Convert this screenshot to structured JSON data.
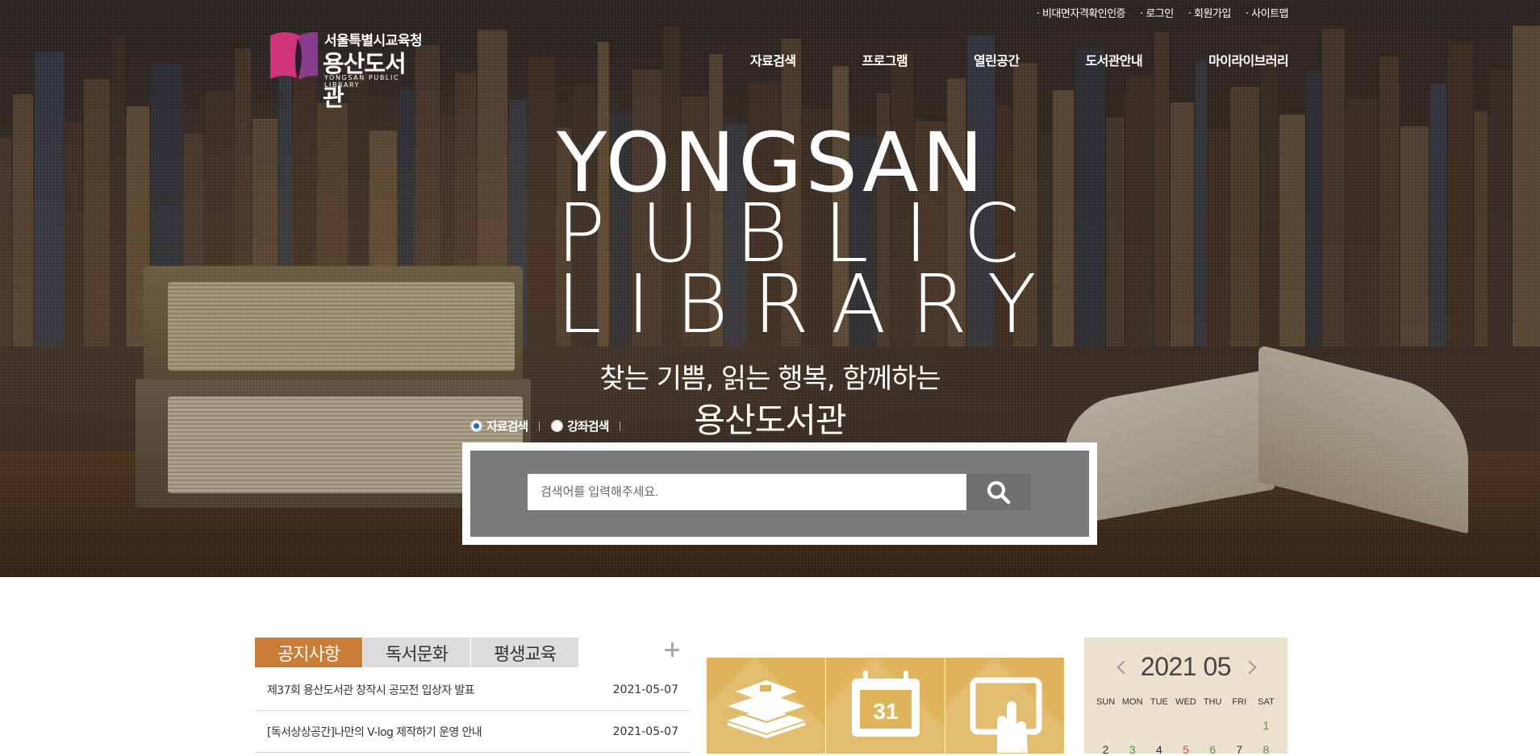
{
  "header": {
    "logo": {
      "sub": "서울특별시교육청",
      "main": "용산도서관",
      "eng": "YONGSAN PUBLIC LIBRARY"
    },
    "util_links": [
      "비대면자격확인인증",
      "로그인",
      "회원가입",
      "사이트맵"
    ],
    "nav": [
      "자료검색",
      "프로그램",
      "열린공간",
      "도서관안내",
      "마이라이브러리"
    ]
  },
  "hero": {
    "title_lines": [
      "YONGSAN",
      "PUBLIC",
      "LIBRARY"
    ],
    "slogan_line1": "찾는 기쁨, 읽는 행복, 함께하는",
    "slogan_line2": "용산도서관"
  },
  "search": {
    "options": [
      {
        "label": "자료검색",
        "selected": true
      },
      {
        "label": "강좌검색",
        "selected": false
      }
    ],
    "placeholder": "검색어를 입력해주세요.",
    "button_icon": "search-icon"
  },
  "board": {
    "tabs": [
      {
        "label": "공지사항",
        "active": true
      },
      {
        "label": "독서문화",
        "active": false
      },
      {
        "label": "평생교육",
        "active": false
      }
    ],
    "items": [
      {
        "title": "제37회 용산도서관 창작시 공모전 입상자 발표",
        "date": "2021-05-07"
      },
      {
        "title": "[독서상상공간]나만의 V-log 제작하기 운영 안내",
        "date": "2021-05-07"
      }
    ]
  },
  "quick_menu": {
    "items": [
      {
        "icon": "books-icon"
      },
      {
        "icon": "calendar-icon",
        "day": "31"
      },
      {
        "icon": "touch-screen-icon"
      }
    ],
    "color": "#e0b45c"
  },
  "calendar": {
    "year": "2021",
    "month": "05",
    "weekdays": [
      "SUN",
      "MON",
      "TUE",
      "WED",
      "THU",
      "FRI",
      "SAT"
    ],
    "week1": [
      "",
      "",
      "",
      "",
      "",
      "",
      "1"
    ],
    "week2": [
      "2",
      "3",
      "4",
      "5",
      "6",
      "7",
      "8"
    ],
    "green_days": [
      "1",
      "3",
      "6",
      "8"
    ],
    "red_days": [
      "5"
    ]
  },
  "colors": {
    "accent": "#c97d37",
    "calendar_bg": "#ece1cd",
    "search_bg": "#7a7a7a"
  }
}
